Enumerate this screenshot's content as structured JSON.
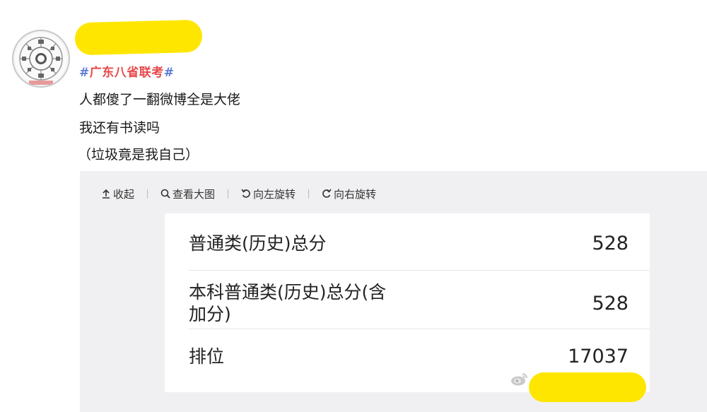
{
  "post": {
    "avatar_icon": "seal-avatar",
    "hashtag": {
      "hash_open": "#",
      "topic": "广东八省联考",
      "hash_close": "#"
    },
    "lines": [
      "人都傻了一翻微博全是大佬",
      "我还有书读吗",
      "（垃圾竟是我自己）"
    ],
    "highlight_color": "#ffe600"
  },
  "viewer": {
    "toolbar": [
      {
        "icon": "collapse-arrow-up-icon",
        "label": "收起"
      },
      {
        "icon": "magnifier-icon",
        "label": "查看大图"
      },
      {
        "icon": "rotate-left-icon",
        "label": "向左旋转"
      },
      {
        "icon": "rotate-right-icon",
        "label": "向右旋转"
      }
    ]
  },
  "score_card": {
    "rows": [
      {
        "label": "普通类(历史)总分",
        "value": "528"
      },
      {
        "label": "本科普通类(历史)总分(含\n加分)",
        "value": "528"
      },
      {
        "label": "排位",
        "value": "17037"
      }
    ]
  },
  "colors": {
    "hash": "#5b7bd6",
    "topic": "#e8484b",
    "panel_bg": "#f0f0f2"
  }
}
